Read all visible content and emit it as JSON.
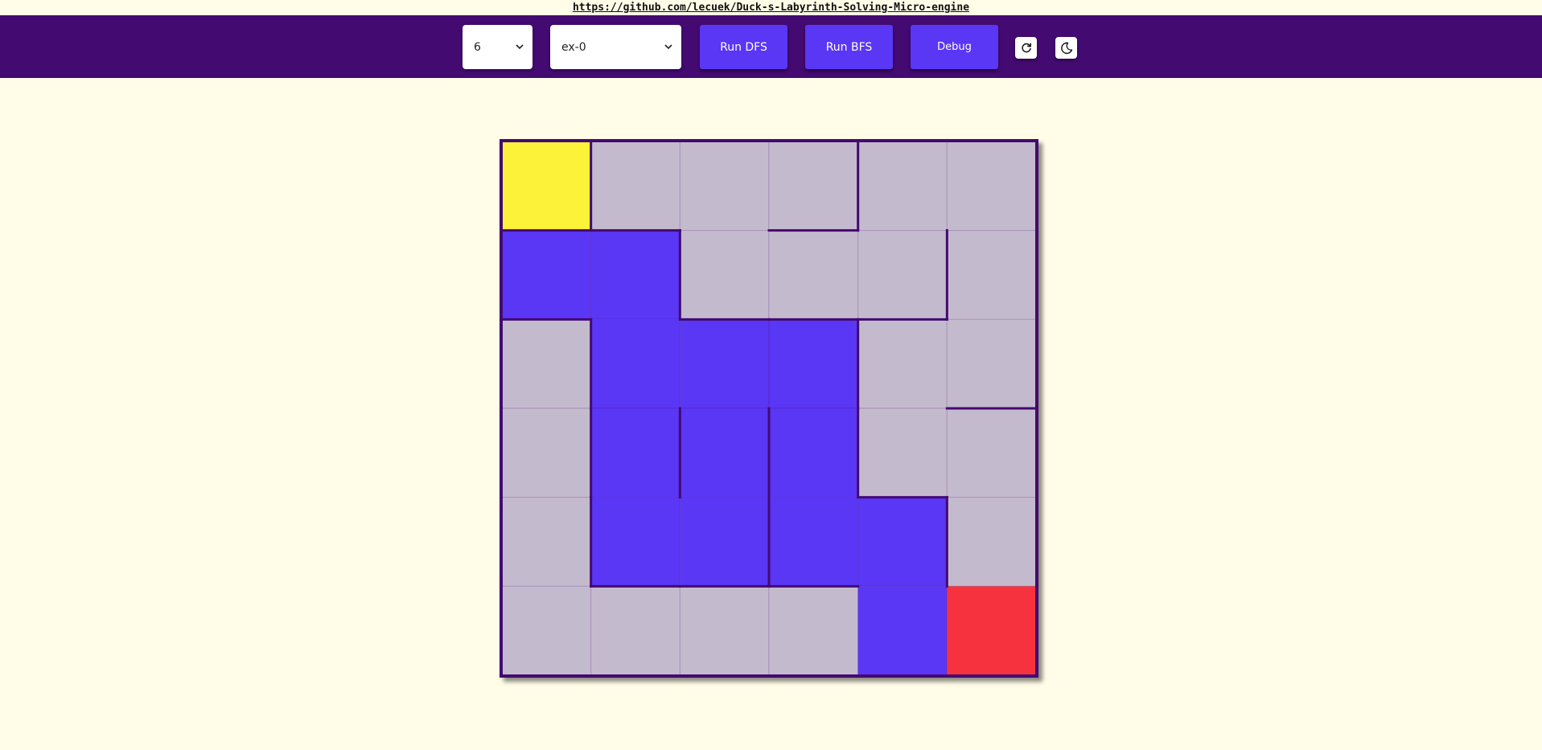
{
  "header": {
    "repo_link": "https://github.com/lecuek/Duck-s-Labyrinth-Solving-Micro-engine"
  },
  "toolbar": {
    "size_select": {
      "value": "6"
    },
    "example_select": {
      "value": "ex-0"
    },
    "run_dfs_label": "Run DFS",
    "run_bfs_label": "Run BFS",
    "debug_label": "Debug",
    "reset_icon": "refresh-icon",
    "theme_icon": "moon-icon"
  },
  "colors": {
    "toolbar_bg": "#430a71",
    "page_bg": "#fffce8",
    "button_bg": "#5a36f5",
    "wall": "#430a71",
    "cell_empty": "#c4bacd",
    "cell_path": "#5a36f5",
    "cell_start": "#fcf23a",
    "cell_end": "#f7323f"
  },
  "maze": {
    "rows": 6,
    "cols": 6,
    "start": [
      0,
      0
    ],
    "end": [
      5,
      5
    ],
    "cells": [
      [
        "start",
        "empty",
        "empty",
        "empty",
        "empty",
        "empty"
      ],
      [
        "path",
        "path",
        "empty",
        "empty",
        "empty",
        "empty"
      ],
      [
        "empty",
        "path",
        "path",
        "path",
        "empty",
        "empty"
      ],
      [
        "empty",
        "path",
        "path",
        "path",
        "empty",
        "empty"
      ],
      [
        "empty",
        "path",
        "path",
        "path",
        "path",
        "empty"
      ],
      [
        "empty",
        "empty",
        "empty",
        "empty",
        "path",
        "end"
      ]
    ],
    "vertical_walls": [
      [
        0,
        1
      ],
      [
        0,
        4
      ],
      [
        1,
        2
      ],
      [
        1,
        5
      ],
      [
        2,
        1
      ],
      [
        2,
        4
      ],
      [
        3,
        1
      ],
      [
        3,
        2
      ],
      [
        3,
        3
      ],
      [
        3,
        4
      ],
      [
        4,
        1
      ],
      [
        4,
        3
      ],
      [
        4,
        5
      ]
    ],
    "horizontal_walls": [
      [
        1,
        0
      ],
      [
        1,
        1
      ],
      [
        1,
        3
      ],
      [
        2,
        0
      ],
      [
        2,
        2
      ],
      [
        2,
        3
      ],
      [
        2,
        4
      ],
      [
        3,
        5
      ],
      [
        4,
        4
      ],
      [
        5,
        1
      ],
      [
        5,
        2
      ],
      [
        5,
        3
      ]
    ]
  }
}
